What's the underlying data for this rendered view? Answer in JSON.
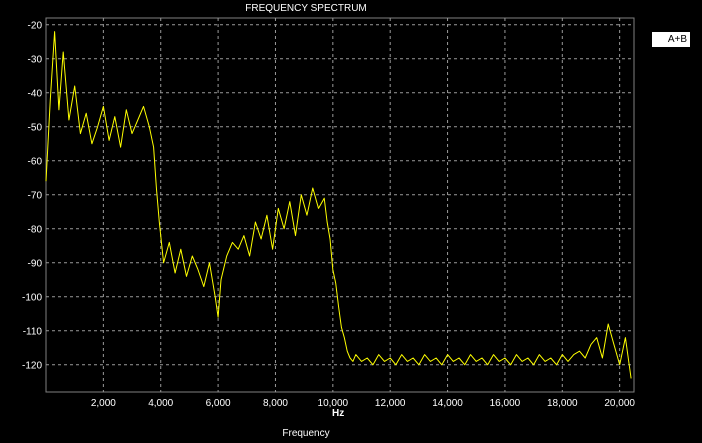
{
  "chart_data": {
    "type": "line",
    "title": "FREQUENCY SPECTRUM",
    "xlabel": "Frequency",
    "x_unit_label": "Hz",
    "ylabel": "",
    "xlim": [
      0,
      20500
    ],
    "ylim": [
      -128,
      -18
    ],
    "x_ticks": [
      2000,
      4000,
      6000,
      8000,
      10000,
      12000,
      14000,
      16000,
      18000,
      20000
    ],
    "x_tick_labels": [
      "2,000",
      "4,000",
      "6,000",
      "8,000",
      "10,000",
      "12,000",
      "14,000",
      "16,000",
      "18,000",
      "20,000"
    ],
    "y_ticks": [
      -20,
      -30,
      -40,
      -50,
      -60,
      -70,
      -80,
      -90,
      -100,
      -110,
      -120
    ],
    "y_tick_labels": [
      "-20",
      "-30",
      "-40",
      "-50",
      "-60",
      "-70",
      "-80",
      "-90",
      "-100",
      "-110",
      "-120"
    ],
    "grid": true,
    "legend_position": "top-right",
    "series": [
      {
        "name": "A+B",
        "color": "#ffff00",
        "x": [
          0,
          150,
          300,
          450,
          600,
          800,
          1000,
          1200,
          1400,
          1600,
          1800,
          2000,
          2200,
          2400,
          2600,
          2800,
          3000,
          3200,
          3400,
          3600,
          3750,
          3850,
          3950,
          4100,
          4300,
          4500,
          4700,
          4900,
          5100,
          5300,
          5500,
          5700,
          5900,
          6000,
          6100,
          6300,
          6500,
          6700,
          6900,
          7100,
          7300,
          7500,
          7700,
          7900,
          8100,
          8300,
          8500,
          8700,
          8900,
          9100,
          9300,
          9500,
          9700,
          9800,
          9900,
          10000,
          10100,
          10200,
          10300,
          10400,
          10500,
          10600,
          10700,
          10800,
          11000,
          11200,
          11400,
          11600,
          11800,
          12000,
          12200,
          12400,
          12600,
          12800,
          13000,
          13200,
          13400,
          13600,
          13800,
          14000,
          14200,
          14400,
          14600,
          14800,
          15000,
          15200,
          15400,
          15600,
          15800,
          16000,
          16200,
          16400,
          16600,
          16800,
          17000,
          17200,
          17400,
          17600,
          17800,
          18000,
          18200,
          18400,
          18600,
          18800,
          19000,
          19200,
          19400,
          19600,
          19800,
          20000,
          20200,
          20400
        ],
        "values": [
          -66,
          -42,
          -22,
          -45,
          -28,
          -48,
          -38,
          -52,
          -46,
          -55,
          -50,
          -44,
          -54,
          -47,
          -56,
          -45,
          -52,
          -48,
          -44,
          -50,
          -56,
          -68,
          -78,
          -90,
          -84,
          -93,
          -86,
          -94,
          -88,
          -92,
          -97,
          -90,
          -100,
          -106,
          -95,
          -88,
          -84,
          -86,
          -82,
          -88,
          -78,
          -83,
          -76,
          -86,
          -74,
          -80,
          -72,
          -82,
          -70,
          -76,
          -68,
          -74,
          -71,
          -78,
          -83,
          -92,
          -96,
          -103,
          -109,
          -112,
          -116,
          -118,
          -119,
          -117,
          -119,
          -118,
          -120,
          -117,
          -119,
          -118,
          -120,
          -117,
          -119,
          -118,
          -120,
          -117,
          -119,
          -118,
          -120,
          -117,
          -119,
          -118,
          -120,
          -117,
          -119,
          -118,
          -120,
          -117,
          -119,
          -118,
          -120,
          -117,
          -119,
          -118,
          -120,
          -117,
          -119,
          -118,
          -120,
          -117,
          -119,
          -117,
          -116,
          -118,
          -114,
          -112,
          -118,
          -108,
          -114,
          -120,
          -112,
          -124
        ]
      }
    ]
  }
}
